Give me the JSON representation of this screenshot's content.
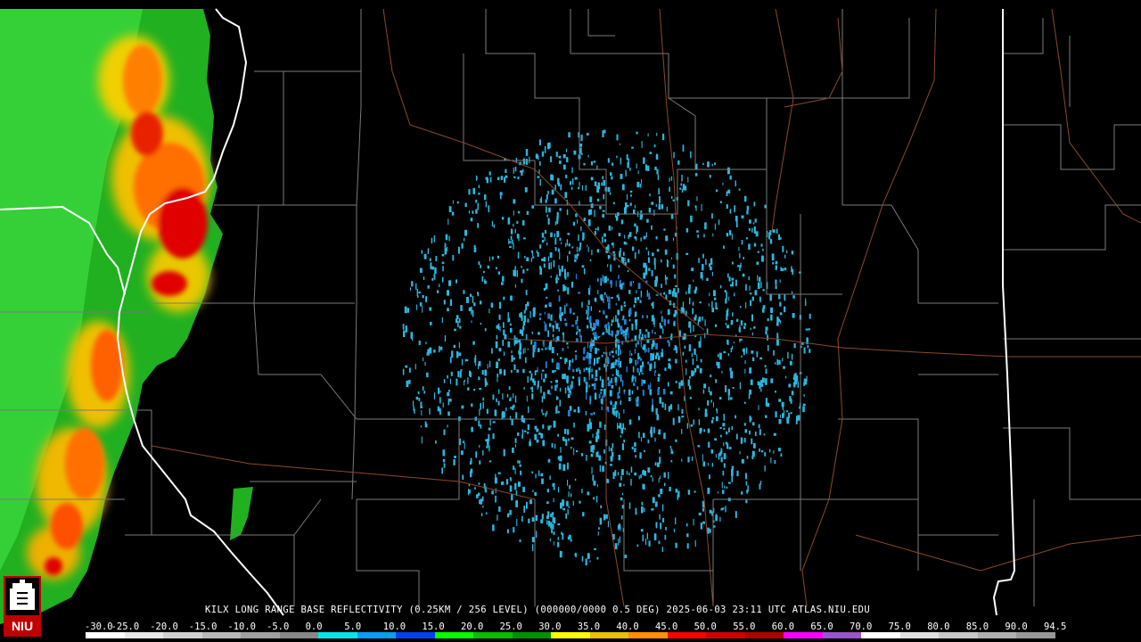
{
  "caption": "KILX LONG RANGE BASE REFLECTIVITY (0.25KM / 256 LEVEL) (000000/0000 0.5 DEG) 2025-06-03 23:11 UTC  ATLAS.NIU.EDU",
  "logo": {
    "text": "NIU",
    "icon": "niu-logo-icon"
  },
  "legend": {
    "ticks": [
      "-30.0",
      "-25.0",
      "-20.0",
      "-15.0",
      "-10.0",
      "-5.0",
      "0.0",
      "5.0",
      "10.0",
      "15.0",
      "20.0",
      "25.0",
      "30.0",
      "35.0",
      "40.0",
      "45.0",
      "50.0",
      "55.0",
      "60.0",
      "65.0",
      "70.0",
      "75.0",
      "80.0",
      "85.0",
      "90.0",
      "94.5"
    ],
    "colors": [
      "#ffffff",
      "#e8e8e8",
      "#d0d0d0",
      "#b8b8b8",
      "#a0a0a0",
      "#888888",
      "#00e8e8",
      "#00a0f0",
      "#0040f0",
      "#00ff00",
      "#00c000",
      "#009000",
      "#ffff00",
      "#e8c000",
      "#ff9000",
      "#ff0000",
      "#d00000",
      "#b00000",
      "#ff00ff",
      "#9955c9",
      "#ffffff",
      "#e0e0e0",
      "#c8c8c8",
      "#b0b0b0",
      "#989898"
    ]
  },
  "colors": {
    "background": "#000000",
    "county_lines": "#7a7a7a",
    "state_lines": "#ffffff",
    "highways": "#8a4a2a",
    "clutter": "#2bb8e0",
    "clutter_dark": "#1f7fd6"
  }
}
